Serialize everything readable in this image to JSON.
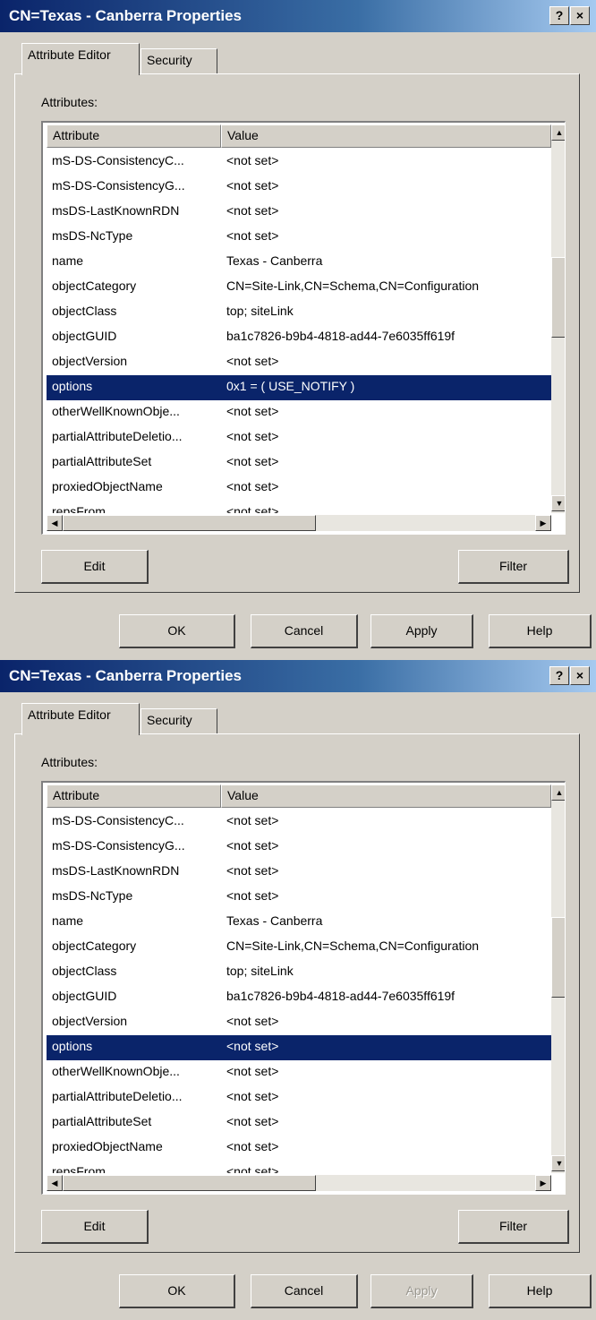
{
  "dialogs": [
    {
      "title": "CN=Texas - Canberra Properties",
      "title_buttons": {
        "help": "?",
        "close": "×"
      },
      "tabs": [
        {
          "label": "Attribute Editor",
          "active": true
        },
        {
          "label": "Security",
          "active": false
        }
      ],
      "attributes_label": "Attributes:",
      "columns": [
        "Attribute",
        "Value"
      ],
      "rows": [
        {
          "attribute": "mS-DS-ConsistencyC...",
          "value": "<not set>"
        },
        {
          "attribute": "mS-DS-ConsistencyG...",
          "value": "<not set>"
        },
        {
          "attribute": "msDS-LastKnownRDN",
          "value": "<not set>"
        },
        {
          "attribute": "msDS-NcType",
          "value": "<not set>"
        },
        {
          "attribute": "name",
          "value": "Texas - Canberra"
        },
        {
          "attribute": "objectCategory",
          "value": "CN=Site-Link,CN=Schema,CN=Configuration"
        },
        {
          "attribute": "objectClass",
          "value": "top; siteLink"
        },
        {
          "attribute": "objectGUID",
          "value": "ba1c7826-b9b4-4818-ad44-7e6035ff619f"
        },
        {
          "attribute": "objectVersion",
          "value": "<not set>"
        },
        {
          "attribute": "options",
          "value": "0x1 = ( USE_NOTIFY )",
          "selected": true
        },
        {
          "attribute": "otherWellKnownObje...",
          "value": "<not set>"
        },
        {
          "attribute": "partialAttributeDeletio...",
          "value": "<not set>"
        },
        {
          "attribute": "partialAttributeSet",
          "value": "<not set>"
        },
        {
          "attribute": "proxiedObjectName",
          "value": "<not set>"
        },
        {
          "attribute": "repsFrom",
          "value": "<not set>"
        }
      ],
      "buttons": {
        "edit": "Edit",
        "filter": "Filter",
        "ok": "OK",
        "cancel": "Cancel",
        "apply": "Apply",
        "help": "Help"
      },
      "apply_enabled": true,
      "icons": [
        "help-icon",
        "close-icon",
        "scroll-up-icon",
        "scroll-down-icon",
        "scroll-left-icon",
        "scroll-right-icon"
      ]
    },
    {
      "title": "CN=Texas - Canberra Properties",
      "title_buttons": {
        "help": "?",
        "close": "×"
      },
      "tabs": [
        {
          "label": "Attribute Editor",
          "active": true
        },
        {
          "label": "Security",
          "active": false
        }
      ],
      "attributes_label": "Attributes:",
      "columns": [
        "Attribute",
        "Value"
      ],
      "rows": [
        {
          "attribute": "mS-DS-ConsistencyC...",
          "value": "<not set>"
        },
        {
          "attribute": "mS-DS-ConsistencyG...",
          "value": "<not set>"
        },
        {
          "attribute": "msDS-LastKnownRDN",
          "value": "<not set>"
        },
        {
          "attribute": "msDS-NcType",
          "value": "<not set>"
        },
        {
          "attribute": "name",
          "value": "Texas - Canberra"
        },
        {
          "attribute": "objectCategory",
          "value": "CN=Site-Link,CN=Schema,CN=Configuration"
        },
        {
          "attribute": "objectClass",
          "value": "top; siteLink"
        },
        {
          "attribute": "objectGUID",
          "value": "ba1c7826-b9b4-4818-ad44-7e6035ff619f"
        },
        {
          "attribute": "objectVersion",
          "value": "<not set>"
        },
        {
          "attribute": "options",
          "value": "<not set>",
          "selected": true
        },
        {
          "attribute": "otherWellKnownObje...",
          "value": "<not set>"
        },
        {
          "attribute": "partialAttributeDeletio...",
          "value": "<not set>"
        },
        {
          "attribute": "partialAttributeSet",
          "value": "<not set>"
        },
        {
          "attribute": "proxiedObjectName",
          "value": "<not set>"
        },
        {
          "attribute": "repsFrom",
          "value": "<not set>"
        }
      ],
      "buttons": {
        "edit": "Edit",
        "filter": "Filter",
        "ok": "OK",
        "cancel": "Cancel",
        "apply": "Apply",
        "help": "Help"
      },
      "apply_enabled": false,
      "icons": [
        "help-icon",
        "close-icon",
        "scroll-up-icon",
        "scroll-down-icon",
        "scroll-left-icon",
        "scroll-right-icon"
      ]
    }
  ],
  "colors": {
    "title_gradient_start": "#0a246a",
    "title_gradient_end": "#a6caf0",
    "selection": "#0a246a",
    "dialog_face": "#d4d0c8"
  }
}
